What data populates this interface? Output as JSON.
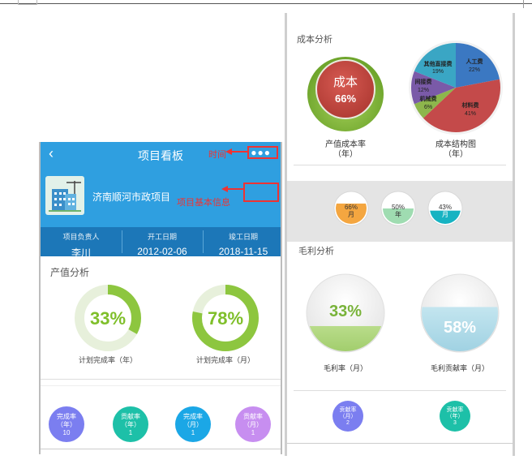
{
  "left_phone": {
    "header": {
      "title": "项目看板",
      "back_icon": "chevron-left-icon",
      "more_icon": "more-dots-icon"
    },
    "project": {
      "name": "济南顺河市政项目"
    },
    "info": [
      {
        "label": "项目负责人",
        "value": "李川"
      },
      {
        "label": "开工日期",
        "value": "2012-02-06"
      },
      {
        "label": "竣工日期",
        "value": "2018-11-15"
      }
    ],
    "output_analysis": {
      "title": "产值分析",
      "gauges": [
        {
          "value": "33%",
          "label": "计划完成率（年）",
          "fraction": 0.33
        },
        {
          "value": "78%",
          "label": "计划完成率（月）",
          "fraction": 0.78
        }
      ]
    },
    "bubbles": [
      {
        "line1": "完成率",
        "line2": "（年）",
        "value": "10",
        "color": "#7b7ef0"
      },
      {
        "line1": "贡献率",
        "line2": "（年）",
        "value": "1",
        "color": "#1dc0a8"
      },
      {
        "line1": "完成率",
        "line2": "（月）",
        "value": "1",
        "color": "#1ba7e6"
      },
      {
        "line1": "贡献率",
        "line2": "（月）",
        "value": "1",
        "color": "#c78ef0"
      }
    ]
  },
  "annotations": {
    "time": "时间",
    "project_info": "项目基本信息"
  },
  "right_phone": {
    "cost_analysis": {
      "title": "成本分析",
      "ratio": {
        "label": "成本",
        "value": "66%",
        "caption1": "产值成本率",
        "caption2": "（年）"
      },
      "pie_caption1": "成本结构图",
      "pie_caption2": "（年）"
    },
    "period_pills": [
      {
        "value": "66%",
        "period": "月",
        "fraction": 0.66,
        "color": "#f4a640"
      },
      {
        "value": "50%",
        "period": "年",
        "fraction": 0.5,
        "color": "#9fdcb1"
      },
      {
        "value": "43%",
        "period": "月",
        "fraction": 0.43,
        "color": "#17b3c2"
      }
    ],
    "gross_margin": {
      "title": "毛利分析",
      "items": [
        {
          "value": "33%",
          "label": "毛利率（月）",
          "fraction": 0.33
        },
        {
          "value": "58%",
          "label": "毛利贡献率（月）",
          "fraction": 0.58
        }
      ]
    },
    "bottom_bubbles": [
      {
        "line1": "贡献率",
        "line2": "（月）",
        "value": "2",
        "color": "#7b7ef0"
      },
      {
        "line1": "贡献率",
        "line2": "（年）",
        "value": "3",
        "color": "#1dc0a8"
      }
    ]
  },
  "chart_data": {
    "type": "pie",
    "title": "",
    "slices": [
      {
        "label": "人工费",
        "value": 22,
        "color": "#3b78c2"
      },
      {
        "label": "材料费",
        "value": 41,
        "color": "#c44a4a"
      },
      {
        "label": "机械费",
        "value": 6,
        "color": "#8db64c"
      },
      {
        "label": "间接费",
        "value": 12,
        "color": "#7a5aa8"
      },
      {
        "label": "其他直接费",
        "value": 19,
        "color": "#3aa6c4"
      }
    ],
    "slice_labels_printed": [
      "其他直接费",
      "19%",
      "人工费",
      "22%",
      "间接费",
      "12%",
      "机械费",
      "6%",
      "材料费",
      "41%"
    ]
  }
}
